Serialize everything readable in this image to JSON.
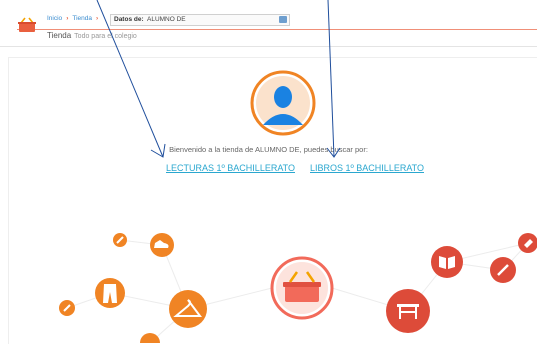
{
  "breadcrumb": {
    "items": [
      "Inicio",
      "Tienda"
    ],
    "datos_label": "Datos de:",
    "student_value": "ALUMNO DE"
  },
  "section": {
    "title": "Tienda",
    "subtitle": "Todo para el colegio"
  },
  "welcome": {
    "text": "Bienvenido a la tienda de ALUMNO DE, puedes buscar por:",
    "link_lecturas": "LECTURAS 1º BACHILLERATO",
    "link_libros": "LIBROS 1º BACHILLERATO"
  },
  "colors": {
    "accent": "#e9603f",
    "link": "#2aa7cf",
    "orange": "#f08424",
    "red": "#dd4b39",
    "basket_bg": "#f26a5a",
    "arrow": "#1f4e9c"
  }
}
